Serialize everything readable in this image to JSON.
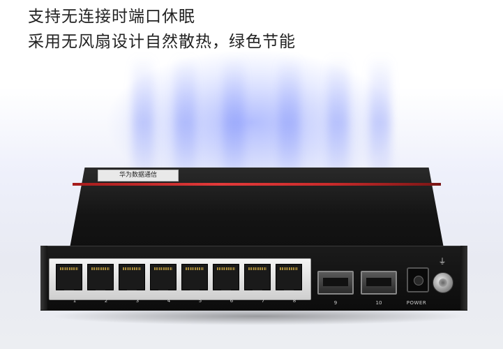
{
  "headline": {
    "line1": "支持无连接时端口休眠",
    "line2": "采用无风扇设计自然散热，绿色节能"
  },
  "device": {
    "brand_plate_text": "华为数据通信",
    "rj45_ports": [
      "1",
      "2",
      "3",
      "4",
      "5",
      "6",
      "7",
      "8"
    ],
    "sfp_ports": [
      "9",
      "10"
    ],
    "power_label": "POWER",
    "accent_color": "#d92b2b"
  }
}
